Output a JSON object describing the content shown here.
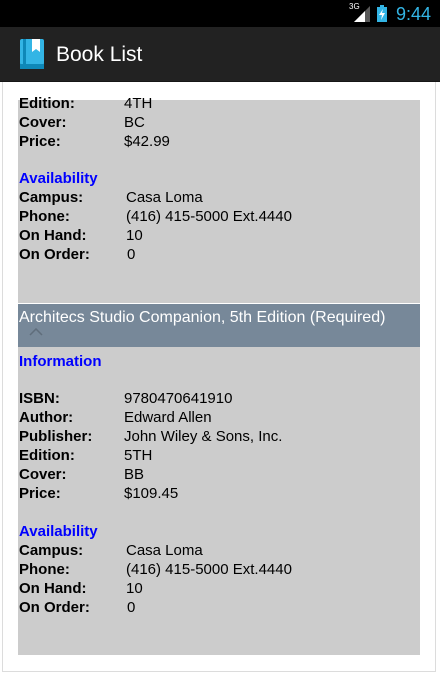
{
  "status_bar": {
    "network": "3G",
    "time": "9:44",
    "clock_color": "#33b5e5"
  },
  "action_bar": {
    "title": "Book List",
    "icon": "book-list-icon"
  },
  "book_1_partial": {
    "rows": [
      {
        "label": "Edition:",
        "value": "4TH"
      },
      {
        "label": "Cover:",
        "value": "BC"
      },
      {
        "label": "Price:",
        "value": "$42.99"
      }
    ],
    "availability_heading": "Availability",
    "availability": [
      {
        "label": "Campus:",
        "value": "Casa Loma"
      },
      {
        "label": "Phone:",
        "value": "(416) 415-5000 Ext.4440"
      },
      {
        "label": "On Hand:",
        "value": "10"
      },
      {
        "label": "On Order:",
        "value": "0"
      }
    ]
  },
  "book_2": {
    "title": "Architecs Studio Companion, 5th Edition (Required)",
    "information_heading": "Information",
    "information": [
      {
        "label": "ISBN:",
        "value": "9780470641910"
      },
      {
        "label": "Author:",
        "value": "Edward Allen"
      },
      {
        "label": "Publisher:",
        "value": "John Wiley & Sons, Inc."
      },
      {
        "label": "Edition:",
        "value": "5TH"
      },
      {
        "label": "Cover:",
        "value": "BB"
      },
      {
        "label": "Price:",
        "value": "$109.45"
      }
    ],
    "availability_heading": "Availability",
    "availability": [
      {
        "label": "Campus:",
        "value": "Casa Loma"
      },
      {
        "label": "Phone:",
        "value": "(416) 415-5000 Ext.4440"
      },
      {
        "label": "On Hand:",
        "value": "10"
      },
      {
        "label": "On Order:",
        "value": "0"
      }
    ]
  },
  "colors": {
    "action_bar": "#222222",
    "card_background": "#cccccc",
    "group_header": "#778899",
    "section_heading": "#0000ff"
  }
}
